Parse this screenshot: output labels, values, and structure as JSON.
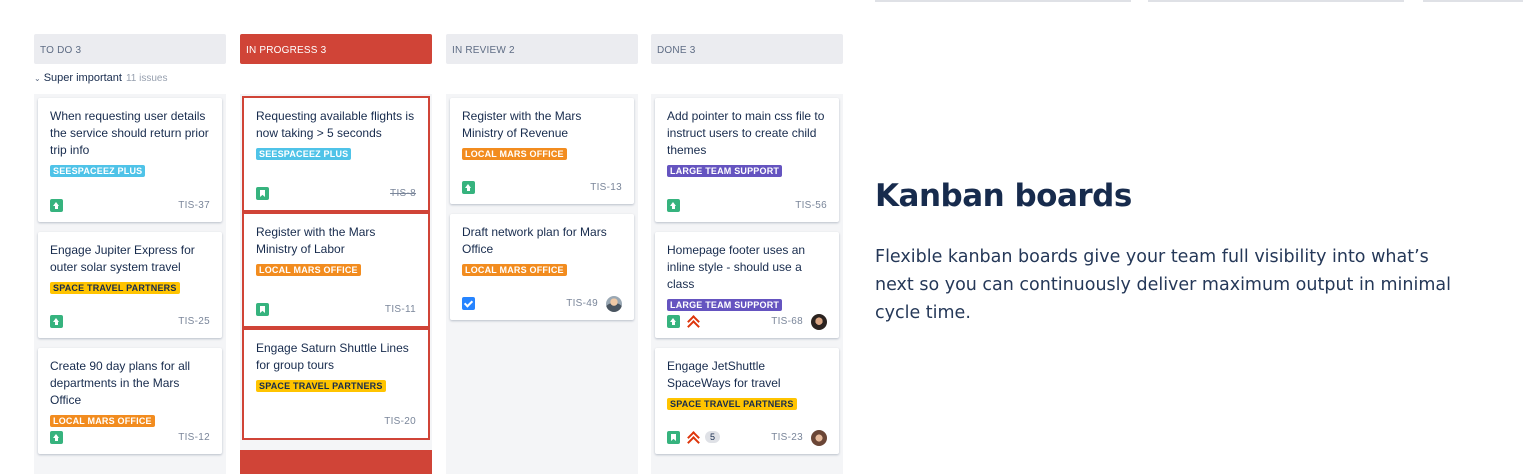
{
  "columns": [
    {
      "title": "TO DO",
      "count": "3"
    },
    {
      "title": "IN PROGRESS",
      "count": "3"
    },
    {
      "title": "IN REVIEW",
      "count": "2"
    },
    {
      "title": "DONE",
      "count": "3"
    }
  ],
  "swimlane": {
    "name": "Super important",
    "issue_count": "11 issues"
  },
  "cards": {
    "todo": [
      {
        "summary": "When requesting user details the service should return prior trip info",
        "label": "SEESPACEEZ PLUS",
        "key": "TIS-37"
      },
      {
        "summary": "Engage Jupiter Express for outer solar system travel",
        "label": "SPACE TRAVEL PARTNERS",
        "key": "TIS-25"
      },
      {
        "summary": "Create 90 day plans for all departments in the Mars Office",
        "label": "LOCAL MARS OFFICE",
        "key": "TIS-12"
      }
    ],
    "inprogress": [
      {
        "summary": "Requesting available flights is now taking > 5 seconds",
        "label": "SEESPACEEZ PLUS",
        "key": "TIS-8"
      },
      {
        "summary": "Register with the Mars Ministry of Labor",
        "label": "LOCAL MARS OFFICE",
        "key": "TIS-11"
      },
      {
        "summary": "Engage Saturn Shuttle Lines for group tours",
        "label": "SPACE TRAVEL PARTNERS",
        "key": "TIS-20"
      }
    ],
    "review": [
      {
        "summary": "Register with the Mars Ministry of Revenue",
        "label": "LOCAL MARS OFFICE",
        "key": "TIS-13"
      },
      {
        "summary": "Draft network plan for Mars Office",
        "label": "LOCAL MARS OFFICE",
        "key": "TIS-49"
      }
    ],
    "done": [
      {
        "summary": "Add pointer to main css file to instruct users to create child themes",
        "label": "LARGE TEAM SUPPORT",
        "key": "TIS-56"
      },
      {
        "summary": "Homepage footer uses an inline style - should use a class",
        "label": "LARGE TEAM SUPPORT",
        "key": "TIS-68"
      },
      {
        "summary": "Engage JetShuttle SpaceWays for travel",
        "label": "SPACE TRAVEL PARTNERS",
        "key": "TIS-23",
        "badge": "5"
      }
    ]
  },
  "colors": {
    "in_progress": "#D04437",
    "story": "#36B37E",
    "task": "#2684FF",
    "priority": "#DE350B"
  },
  "hero": {
    "title": "Kanban boards",
    "description": "Flexible kanban boards give your team full visibility into what’s next so you can continuously deliver maximum output in minimal cycle time."
  }
}
